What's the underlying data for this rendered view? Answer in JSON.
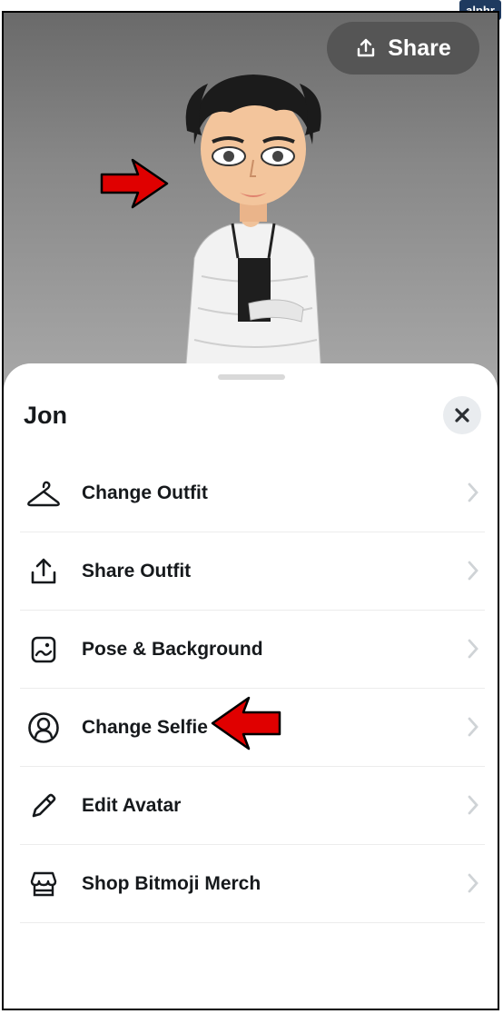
{
  "watermark": "alphr",
  "header": {
    "share_label": "Share"
  },
  "sheet": {
    "title": "Jon",
    "menu": [
      {
        "label": "Change Outfit",
        "icon": "hanger-icon"
      },
      {
        "label": "Share Outfit",
        "icon": "share-upload-icon"
      },
      {
        "label": "Pose & Background",
        "icon": "picture-icon"
      },
      {
        "label": "Change Selfie",
        "icon": "person-circle-icon"
      },
      {
        "label": "Edit Avatar",
        "icon": "pencil-icon"
      },
      {
        "label": "Shop Bitmoji Merch",
        "icon": "shop-icon"
      }
    ]
  },
  "colors": {
    "annotation_arrow": "#e00000",
    "hero_bg": "#808080",
    "text": "#16191c"
  }
}
